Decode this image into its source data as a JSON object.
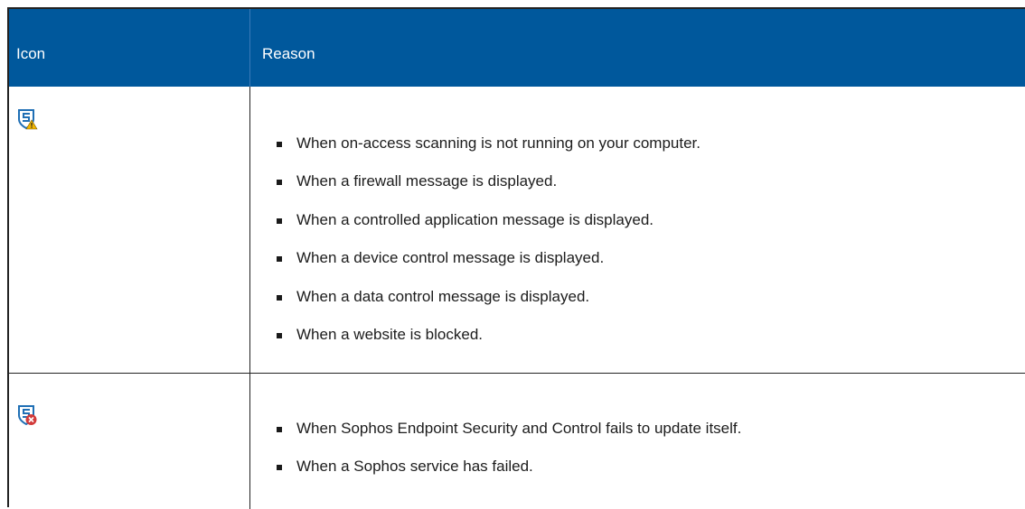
{
  "table": {
    "headers": {
      "icon": "Icon",
      "reason": "Reason"
    },
    "rows": [
      {
        "icon": "sophos-shield-warning-icon",
        "reasons": [
          "When on-access scanning is not running on your computer.",
          "When a firewall message is displayed.",
          "When a controlled application message is displayed.",
          "When a device control message is displayed.",
          "When a data control message is displayed.",
          "When a website is blocked."
        ]
      },
      {
        "icon": "sophos-shield-error-icon",
        "reasons": [
          "When Sophos Endpoint Security and Control fails to update itself.",
          "When a Sophos service has failed."
        ]
      }
    ]
  },
  "colors": {
    "header_bg": "#00589c",
    "header_text": "#ffffff",
    "shield_blue": "#1f6fb5",
    "warning_yellow": "#f2b600",
    "error_red": "#d23a3a"
  }
}
